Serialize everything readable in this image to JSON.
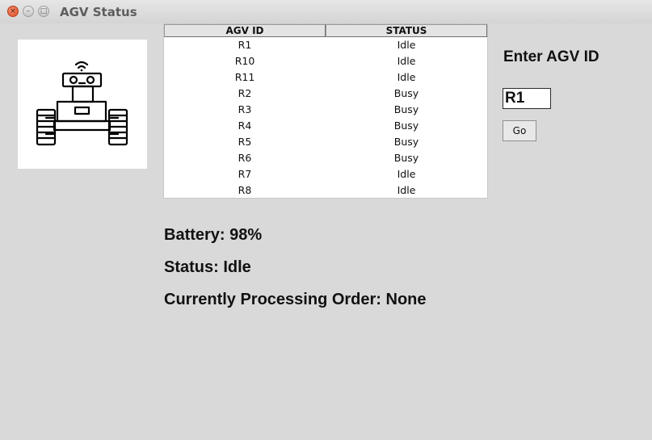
{
  "window": {
    "title": "AGV Status",
    "close_glyph": "×",
    "minimize_glyph": "–",
    "maximize_glyph": "□"
  },
  "robot_image": {
    "icon": "robot-icon"
  },
  "table": {
    "columns": [
      "AGV ID",
      "STATUS"
    ],
    "rows": [
      {
        "id": "R1",
        "status": "Idle"
      },
      {
        "id": "R10",
        "status": "Idle"
      },
      {
        "id": "R11",
        "status": "Idle"
      },
      {
        "id": "R2",
        "status": "Busy"
      },
      {
        "id": "R3",
        "status": "Busy"
      },
      {
        "id": "R4",
        "status": "Busy"
      },
      {
        "id": "R5",
        "status": "Busy"
      },
      {
        "id": "R6",
        "status": "Busy"
      },
      {
        "id": "R7",
        "status": "Idle"
      },
      {
        "id": "R8",
        "status": "Idle"
      }
    ]
  },
  "input": {
    "label": "Enter AGV ID",
    "value": "R1"
  },
  "go_button": {
    "label": "Go"
  },
  "details": {
    "battery": "Battery: 98%",
    "status": "Status: Idle",
    "order": "Currently Processing Order: None"
  },
  "colors": {
    "background": "#d9d9d9",
    "close_button": "#dd4a1f"
  }
}
